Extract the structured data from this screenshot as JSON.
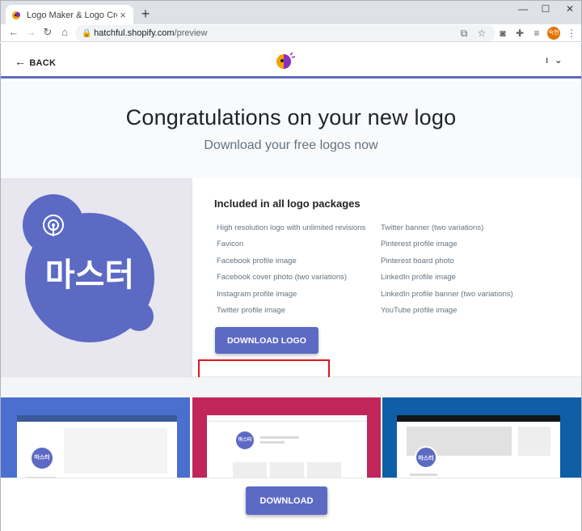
{
  "browser": {
    "tab_title": "Logo Maker & Logo Creator - F",
    "url_host": "hatchful.shopify.com",
    "url_path": "/preview",
    "profile_text": "숙현"
  },
  "nav": {
    "back_label": "BACK",
    "account_label": "ı"
  },
  "hero": {
    "title": "Congratulations on your new logo",
    "subtitle": "Download your free logos now"
  },
  "logo": {
    "text": "마스터",
    "color": "#5c6ac4"
  },
  "packages": {
    "title": "Included in all logo packages",
    "left_items": [
      "High resolution logo with unlimited revisions",
      "Favicon",
      "Facebook profile image",
      "Facebook cover photo (two variations)",
      "Instagram profile image",
      "Twitter profile image"
    ],
    "right_items": [
      "Twitter banner (two variations)",
      "Pinterest profile image",
      "Pinterest board photo",
      "LinkedIn profile image",
      "LinkedIn profile banner (two variations)",
      "YouTube profile image"
    ],
    "download_logo_label": "DOWNLOAD LOGO"
  },
  "previews": [
    {
      "name": "facebook",
      "bg": "#4a6fcf",
      "logo_text": "마스터"
    },
    {
      "name": "instagram",
      "bg": "#c0265a",
      "logo_text": "마스터"
    },
    {
      "name": "twitter",
      "bg": "#0f5ea8",
      "logo_text": "마스터"
    }
  ],
  "footer": {
    "download_label": "DOWNLOAD"
  },
  "colors": {
    "accent": "#5c6ac4",
    "highlight": "#e0161c"
  }
}
